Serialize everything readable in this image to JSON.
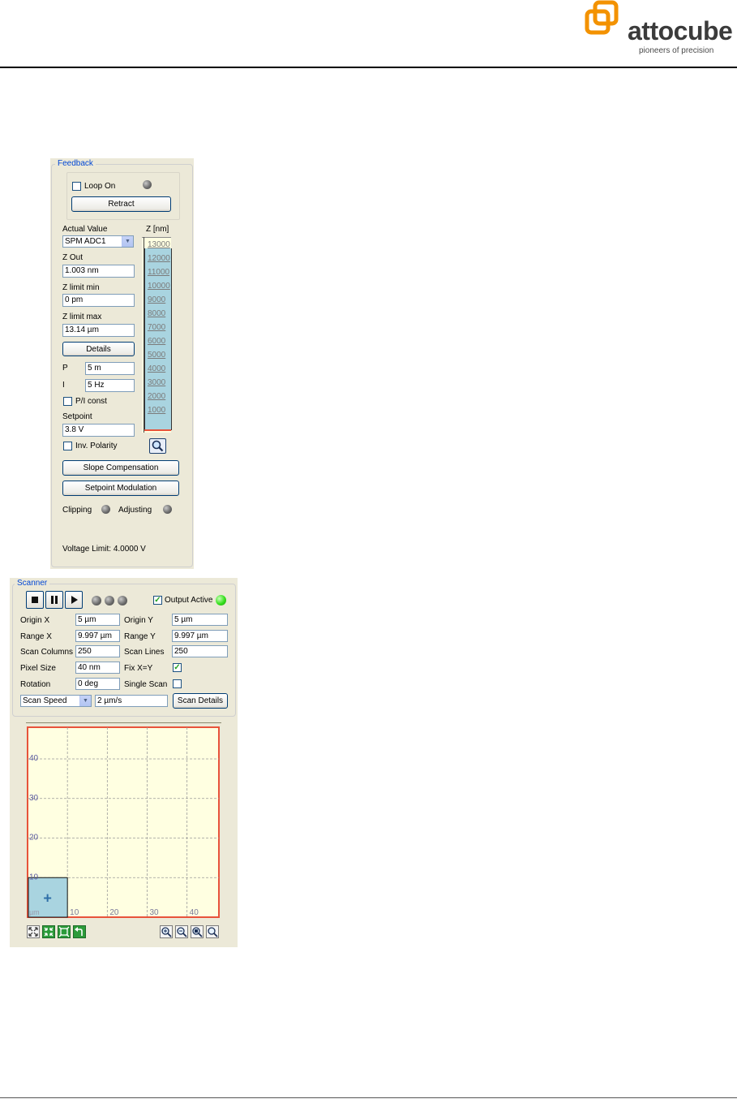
{
  "header": {
    "brand": "attocube",
    "tagline": "pioneers of precision"
  },
  "feedback": {
    "title": "Feedback",
    "loop_on_label": "Loop On",
    "retract_label": "Retract",
    "actual_value_label": "Actual Value",
    "actual_value_select": "SPM ADC1",
    "z_axis_label": "Z [nm]",
    "z_ticks": [
      "13000",
      "12000",
      "11000",
      "10000",
      "9000",
      "8000",
      "7000",
      "6000",
      "5000",
      "4000",
      "3000",
      "2000",
      "1000"
    ],
    "z_out_label": "Z Out",
    "z_out_value": "1.003 nm",
    "z_limit_min_label": "Z limit min",
    "z_limit_min_value": "0 pm",
    "z_limit_max_label": "Z limit max",
    "z_limit_max_value": "13.14 µm",
    "details_label": "Details",
    "p_label": "P",
    "p_value": "5 m",
    "i_label": "I",
    "i_value": "5 Hz",
    "pi_const_label": "P/I const",
    "setpoint_label": "Setpoint",
    "setpoint_value": "3.8 V",
    "inv_polarity_label": "Inv. Polarity",
    "slope_compensation_label": "Slope Compensation",
    "setpoint_modulation_label": "Setpoint Modulation",
    "clipping_label": "Clipping",
    "adjusting_label": "Adjusting",
    "voltage_limit_text": "Voltage Limit: 4.0000 V"
  },
  "scanner": {
    "title": "Scanner",
    "output_active_label": "Output Active",
    "origin_x_label": "Origin X",
    "origin_x_value": "5 µm",
    "origin_y_label": "Origin Y",
    "origin_y_value": "5 µm",
    "range_x_label": "Range X",
    "range_x_value": "9.997 µm",
    "range_y_label": "Range Y",
    "range_y_value": "9.997 µm",
    "scan_columns_label": "Scan Columns",
    "scan_columns_value": "250",
    "scan_lines_label": "Scan Lines",
    "scan_lines_value": "250",
    "pixel_size_label": "Pixel Size",
    "pixel_size_value": "40 nm",
    "fix_xy_label": "Fix X=Y",
    "rotation_label": "Rotation",
    "rotation_value": "0 deg",
    "single_scan_label": "Single Scan",
    "speed_select": "Scan Speed",
    "speed_value": "2 µm/s",
    "scan_details_label": "Scan Details",
    "plot_unit": "µm",
    "plot_x_ticks": [
      "10",
      "20",
      "30",
      "40"
    ],
    "plot_y_ticks": [
      "40",
      "30",
      "20",
      "10"
    ],
    "cursor_glyph": "+"
  },
  "colors": {
    "led_on": "#35e01c",
    "led_off": "#6e6e6e",
    "plot_bg": "#ffffe1",
    "plot_border": "#e8533b",
    "scan_area": "#a9d4e0",
    "z_bar": "#a9d4e0"
  }
}
